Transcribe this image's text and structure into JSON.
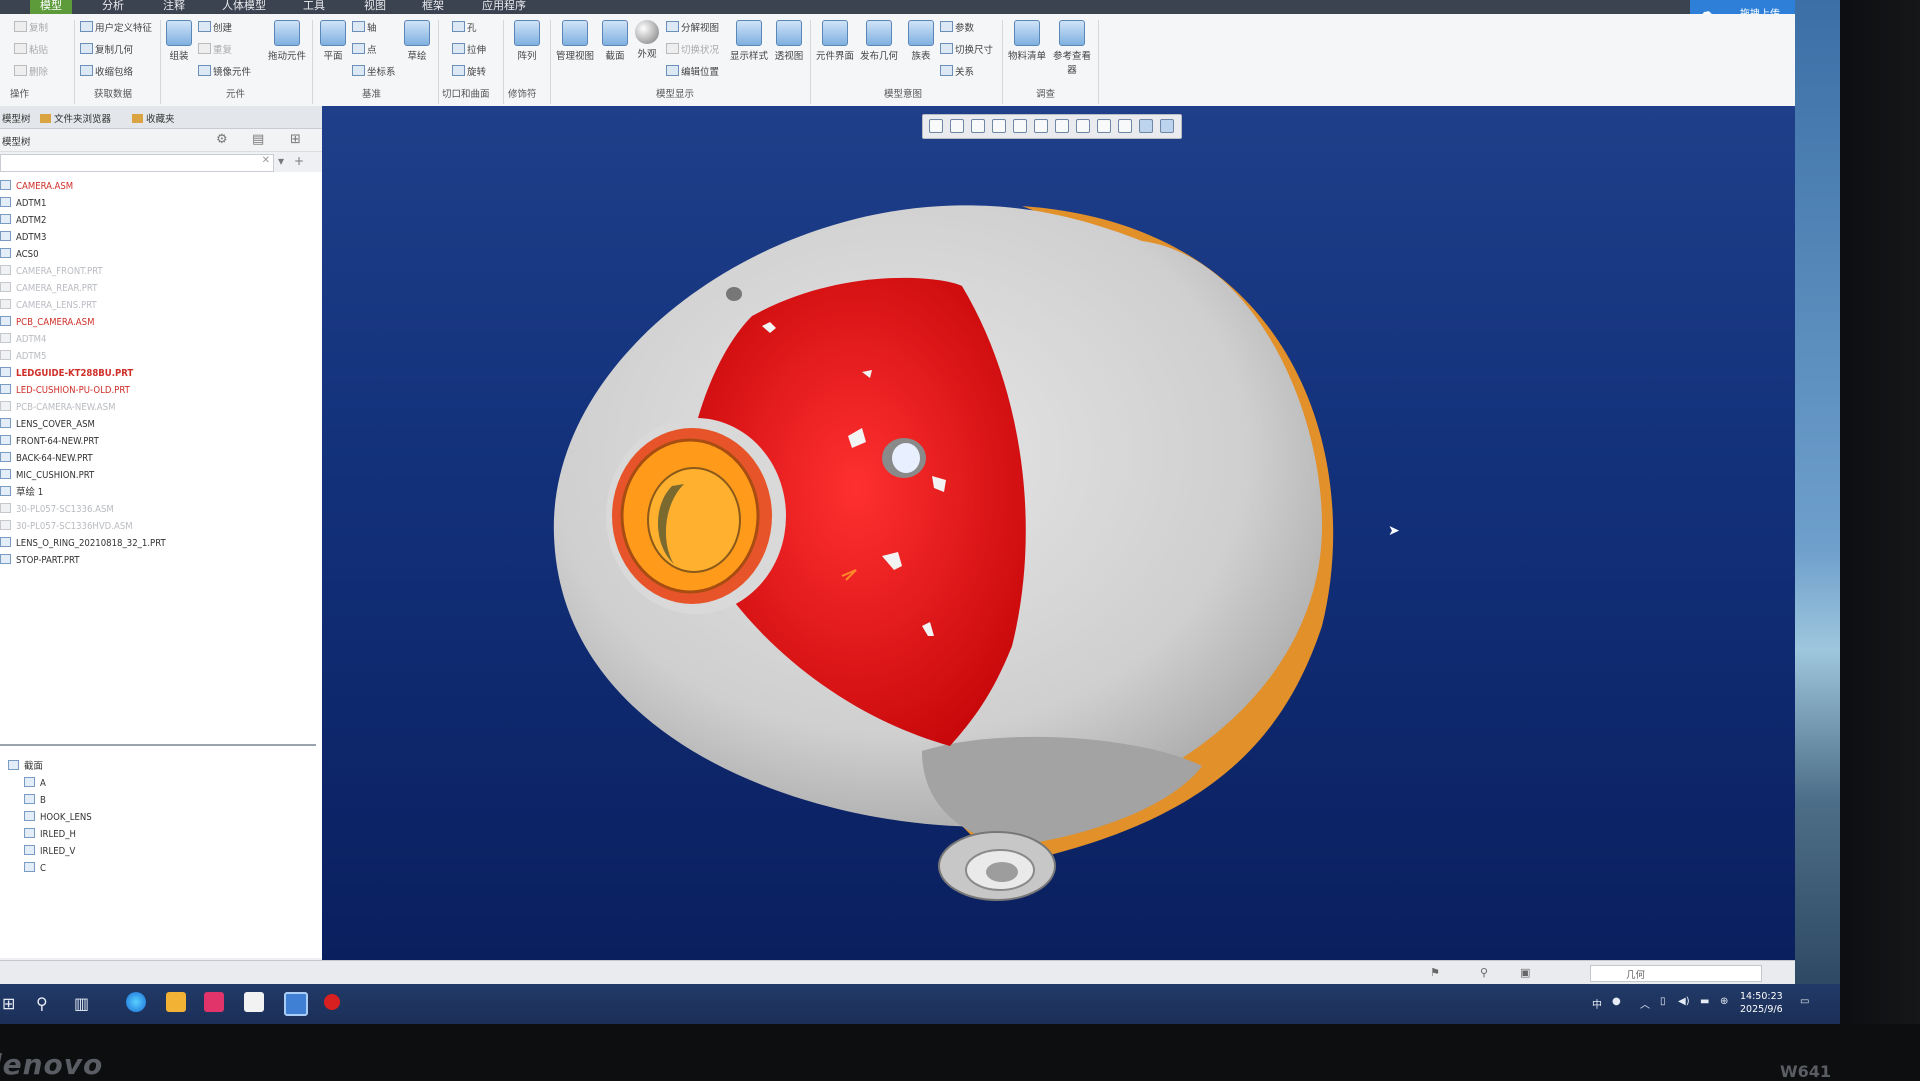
{
  "tabs": [
    "模型",
    "分析",
    "注释",
    "人体模型",
    "工具",
    "视图",
    "框架",
    "应用程序"
  ],
  "share_button": {
    "label": "拖拽上传"
  },
  "ribbon": {
    "operations": {
      "items": [
        "复制",
        "粘贴",
        "删除"
      ],
      "group": "操作"
    },
    "get_data": {
      "items": [
        "用户定义特征",
        "复制几何",
        "收缩包络"
      ],
      "group": "获取数据"
    },
    "components": {
      "big": "组装",
      "items": [
        "创建",
        "重复",
        "镜像元件"
      ],
      "drag": "拖动元件",
      "group": "元件"
    },
    "datum": {
      "plane": "平面",
      "items": [
        "轴",
        "点",
        "坐标系"
      ],
      "sketch": "草绘",
      "group": "基准"
    },
    "cut_surface": {
      "items": [
        "孔",
        "拉伸",
        "旋转"
      ],
      "group": "切口和曲面"
    },
    "modifiers": {
      "pattern": "阵列",
      "group": "修饰符"
    },
    "model_display": {
      "big": [
        "管理视图",
        "截面",
        "外观"
      ],
      "items": [
        "分解视图",
        "切换状况",
        "编辑位置"
      ],
      "style": "显示样式",
      "perspective": "透视图",
      "group": "模型显示"
    },
    "model_intent": {
      "big": [
        "元件界面",
        "发布几何",
        "族表"
      ],
      "items": [
        "参数",
        "切换尺寸",
        "关系"
      ],
      "group": "模型意图"
    },
    "investigate": {
      "big": [
        "物料清单",
        "参考查看器"
      ],
      "group": "调查"
    }
  },
  "nav": {
    "tabs": [
      "模型树",
      "文件夹浏览器",
      "收藏夹"
    ],
    "tree_label": "模型树"
  },
  "tree": [
    {
      "label": "CAMERA.ASM",
      "style": "red"
    },
    {
      "label": "ADTM1",
      "style": "normal"
    },
    {
      "label": "ADTM2",
      "style": "normal"
    },
    {
      "label": "ADTM3",
      "style": "normal"
    },
    {
      "label": "ACS0",
      "style": "normal"
    },
    {
      "label": "CAMERA_FRONT.PRT",
      "style": "dim"
    },
    {
      "label": "CAMERA_REAR.PRT",
      "style": "dim"
    },
    {
      "label": "CAMERA_LENS.PRT",
      "style": "dim"
    },
    {
      "label": "PCB_CAMERA.ASM",
      "style": "red"
    },
    {
      "label": "ADTM4",
      "style": "dim"
    },
    {
      "label": "ADTM5",
      "style": "dim"
    },
    {
      "label": "LEDGUIDE-KT288BU.PRT",
      "style": "redb"
    },
    {
      "label": "LED-CUSHION-PU-OLD.PRT",
      "style": "red"
    },
    {
      "label": "PCB-CAMERA-NEW.ASM",
      "style": "dim"
    },
    {
      "label": "LENS_COVER_ASM",
      "style": "normal"
    },
    {
      "label": "FRONT-64-NEW.PRT",
      "style": "normal"
    },
    {
      "label": "BACK-64-NEW.PRT",
      "style": "normal"
    },
    {
      "label": "MIC_CUSHION.PRT",
      "style": "normal"
    },
    {
      "label": "草绘 1",
      "style": "normal"
    },
    {
      "label": "30-PL057-SC1336.ASM",
      "style": "dim"
    },
    {
      "label": "30-PL057-SC1336HVD.ASM",
      "style": "dim"
    },
    {
      "label": "LENS_O_RING_20210818_32_1.PRT",
      "style": "normal"
    },
    {
      "label": "STOP-PART.PRT",
      "style": "normal"
    }
  ],
  "sections": {
    "title": "截面",
    "items": [
      "A",
      "B",
      "HOOK_LENS",
      "IRLED_H",
      "IRLED_V",
      "C"
    ]
  },
  "status": {
    "filter": "几何"
  },
  "clock": {
    "time": "14:50:23",
    "date": "2025/9/6"
  },
  "tray_ime": "中",
  "bezel": {
    "brand": "lenovo",
    "model": "W641"
  },
  "colors": {
    "viewport_bg": "#12307a",
    "sphere": "#d7d7d7",
    "lens_ring": "#ff9b1a",
    "red_face": "#e60d10",
    "orange_shell": "#ea9a28"
  }
}
